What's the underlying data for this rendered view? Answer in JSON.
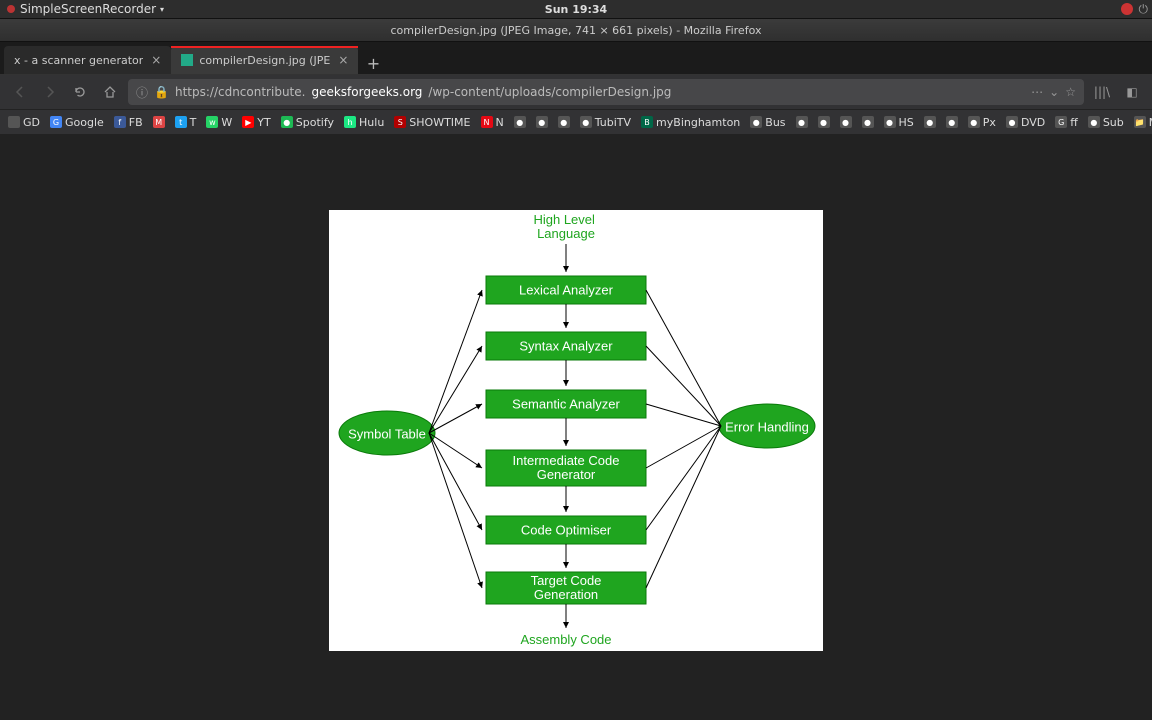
{
  "panel": {
    "app": "SimpleScreenRecorder",
    "clock": "Sun 19:34"
  },
  "window": {
    "title": "compilerDesign.jpg (JPEG Image, 741 × 661 pixels) - Mozilla Firefox"
  },
  "tabs": [
    {
      "label": "x - a scanner generator",
      "active": false
    },
    {
      "label": "compilerDesign.jpg (JPE",
      "active": true
    }
  ],
  "newtab": "+",
  "url": {
    "prefix": "https://cdncontribute.",
    "domain": "geeksforgeeks.org",
    "suffix": "/wp-content/uploads/compilerDesign.jpg"
  },
  "bookmarks": [
    {
      "t": "GD",
      "c": "#555"
    },
    {
      "t": "Google",
      "c": "#4285f4",
      "ico": "G"
    },
    {
      "t": "FB",
      "c": "#3b5998",
      "ico": "f"
    },
    {
      "t": "",
      "c": "#d44",
      "ico": "M"
    },
    {
      "t": "T",
      "c": "#1da1f2",
      "ico": "t"
    },
    {
      "t": "W",
      "c": "#25d366",
      "ico": "w"
    },
    {
      "t": "YT",
      "c": "#ff0000",
      "ico": "▶"
    },
    {
      "t": "Spotify",
      "c": "#1db954",
      "ico": "●"
    },
    {
      "t": "Hulu",
      "c": "#1ce783",
      "ico": "h"
    },
    {
      "t": "SHOWTIME",
      "c": "#b10000",
      "ico": "S"
    },
    {
      "t": "N",
      "c": "#e50914",
      "ico": "N"
    },
    {
      "t": "",
      "c": "#555",
      "ico": "●"
    },
    {
      "t": "",
      "c": "#555",
      "ico": "●"
    },
    {
      "t": "",
      "c": "#555",
      "ico": "●"
    },
    {
      "t": "TubiTV",
      "c": "#555",
      "ico": "●"
    },
    {
      "t": "myBinghamton",
      "c": "#006747",
      "ico": "B"
    },
    {
      "t": "Bus",
      "c": "#555",
      "ico": "●"
    },
    {
      "t": "",
      "c": "#555",
      "ico": "●"
    },
    {
      "t": "",
      "c": "#555",
      "ico": "●"
    },
    {
      "t": "",
      "c": "#555",
      "ico": "●"
    },
    {
      "t": "",
      "c": "#555",
      "ico": "●"
    },
    {
      "t": "HS",
      "c": "#555",
      "ico": "●"
    },
    {
      "t": "",
      "c": "#555",
      "ico": "●"
    },
    {
      "t": "",
      "c": "#555",
      "ico": "●"
    },
    {
      "t": "Px",
      "c": "#555",
      "ico": "●"
    },
    {
      "t": "DVD",
      "c": "#555",
      "ico": "●"
    },
    {
      "t": "ff",
      "c": "#555",
      "ico": "G"
    },
    {
      "t": "Sub",
      "c": "#555",
      "ico": "●"
    },
    {
      "t": "ML",
      "c": "#555",
      "ico": "📁"
    }
  ],
  "diagram": {
    "top_label": "High Level\nLanguage",
    "bottom_label": "Assembly Code",
    "left_oval": "Symbol Table",
    "right_oval": "Error Handling",
    "phases": [
      "Lexical Analyzer",
      "Syntax Analyzer",
      "Semantic Analyzer",
      "Intermediate Code\nGenerator",
      "Code Optimiser",
      "Target Code\nGeneration"
    ]
  }
}
